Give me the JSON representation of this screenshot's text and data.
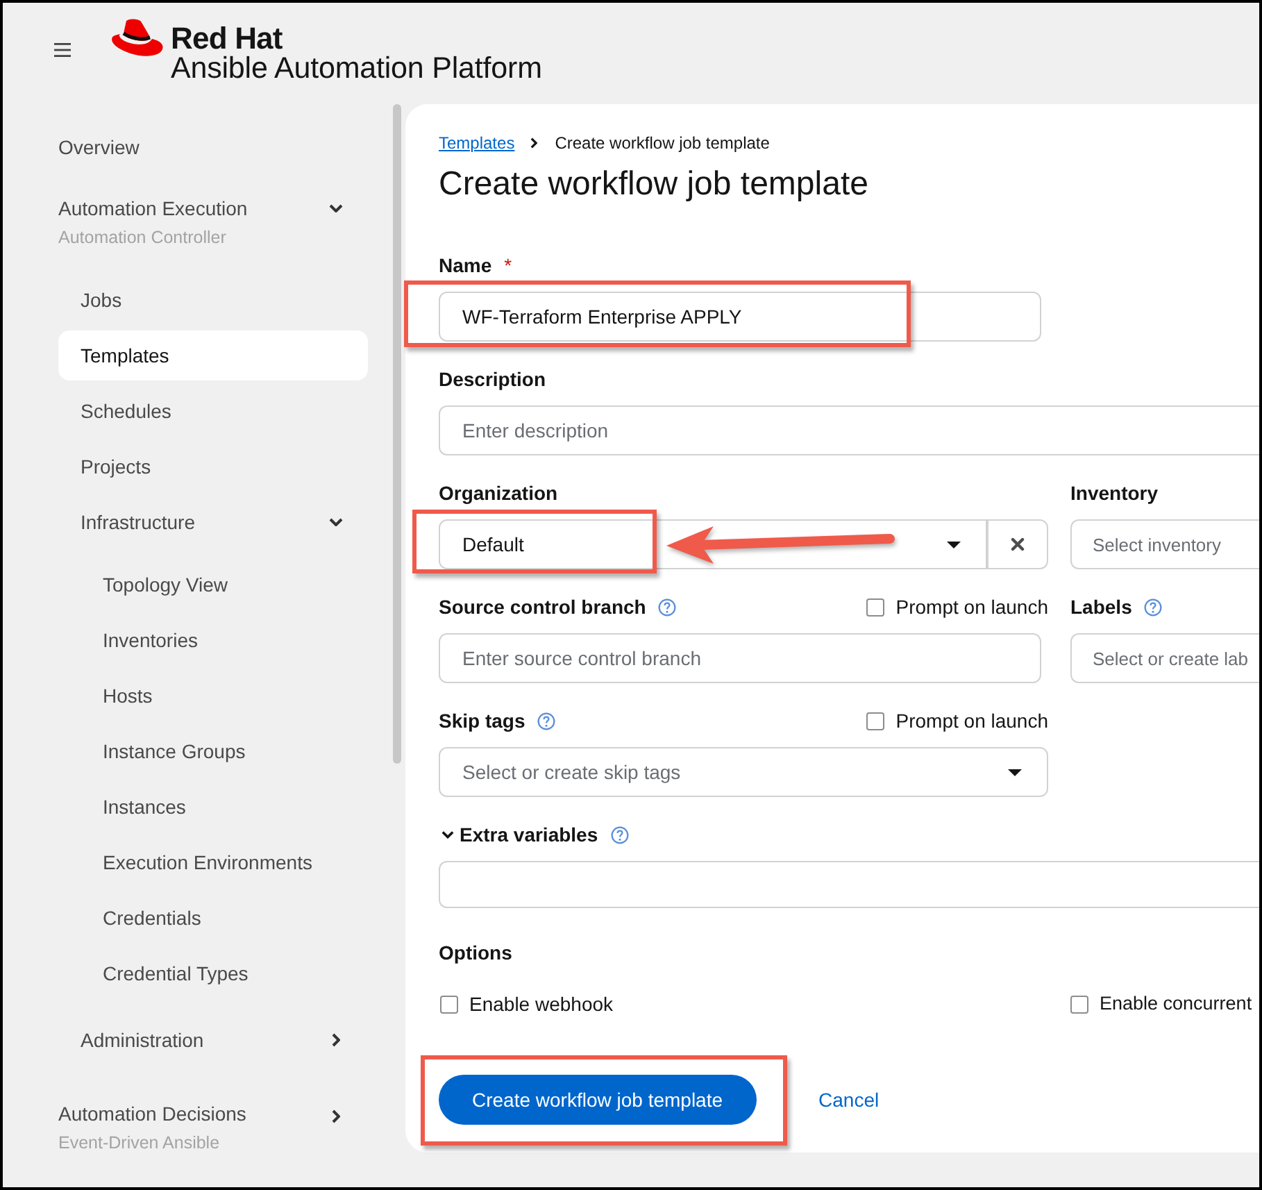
{
  "header": {
    "brand": "Red Hat",
    "product": "Ansible Automation Platform"
  },
  "sidebar": {
    "items": [
      {
        "kind": "link",
        "label": "Overview",
        "selected": false
      },
      {
        "kind": "group",
        "label": "Automation Execution",
        "subtitle": "Automation Controller",
        "expanded": true,
        "selected": false,
        "children": [
          {
            "kind": "link",
            "label": "Jobs",
            "selected": false
          },
          {
            "kind": "link",
            "label": "Templates",
            "selected": true
          },
          {
            "kind": "link",
            "label": "Schedules",
            "selected": false
          },
          {
            "kind": "link",
            "label": "Projects",
            "selected": false
          },
          {
            "kind": "group",
            "label": "Infrastructure",
            "expanded": true,
            "selected": false,
            "children": [
              {
                "kind": "link",
                "label": "Topology View",
                "selected": false
              },
              {
                "kind": "link",
                "label": "Inventories",
                "selected": false
              },
              {
                "kind": "link",
                "label": "Hosts",
                "selected": false
              },
              {
                "kind": "link",
                "label": "Instance Groups",
                "selected": false
              },
              {
                "kind": "link",
                "label": "Instances",
                "selected": false
              },
              {
                "kind": "link",
                "label": "Execution Environments",
                "selected": false
              },
              {
                "kind": "link",
                "label": "Credentials",
                "selected": false
              },
              {
                "kind": "link",
                "label": "Credential Types",
                "selected": false
              }
            ]
          },
          {
            "kind": "group",
            "label": "Administration",
            "expanded": false,
            "selected": false
          }
        ]
      },
      {
        "kind": "group",
        "label": "Automation Decisions",
        "subtitle": "Event-Driven Ansible",
        "expanded": false,
        "selected": false
      }
    ]
  },
  "breadcrumb": [
    {
      "kind": "link",
      "label": "Templates"
    },
    {
      "kind": "current",
      "label": "Create workflow job template"
    }
  ],
  "page_title": "Create workflow job template",
  "form": {
    "name": {
      "label": "Name",
      "required_mark": "*",
      "value": "WF-Terraform Enterprise APPLY",
      "highlighted": true
    },
    "description": {
      "label": "Description",
      "placeholder": "Enter description"
    },
    "organization": {
      "label": "Organization",
      "value": "Default",
      "highlighted": true,
      "arrow": true
    },
    "inventory": {
      "label": "Inventory",
      "placeholder": "Select inventory"
    },
    "source_control_branch": {
      "label": "Source control branch",
      "help": true,
      "placeholder": "Enter source control branch",
      "prompt": {
        "label": "Prompt on launch",
        "checked": false
      }
    },
    "labels": {
      "label": "Labels",
      "help": true,
      "placeholder": "Select or create lab"
    },
    "skip_tags": {
      "label": "Skip tags",
      "help": true,
      "placeholder": "Select or create skip tags",
      "prompt": {
        "label": "Prompt on launch",
        "checked": false
      }
    },
    "extra_variables": {
      "label": "Extra variables",
      "help": true,
      "expanded": true
    },
    "options": {
      "label": "Options",
      "items": [
        {
          "label": "Enable webhook",
          "checked": false
        },
        {
          "label": "Enable concurrent",
          "checked": false
        }
      ]
    }
  },
  "actions": [
    {
      "kind": "primary",
      "label": "Create workflow job template",
      "highlighted": true
    },
    {
      "kind": "link",
      "label": "Cancel",
      "highlighted": false
    }
  ]
}
